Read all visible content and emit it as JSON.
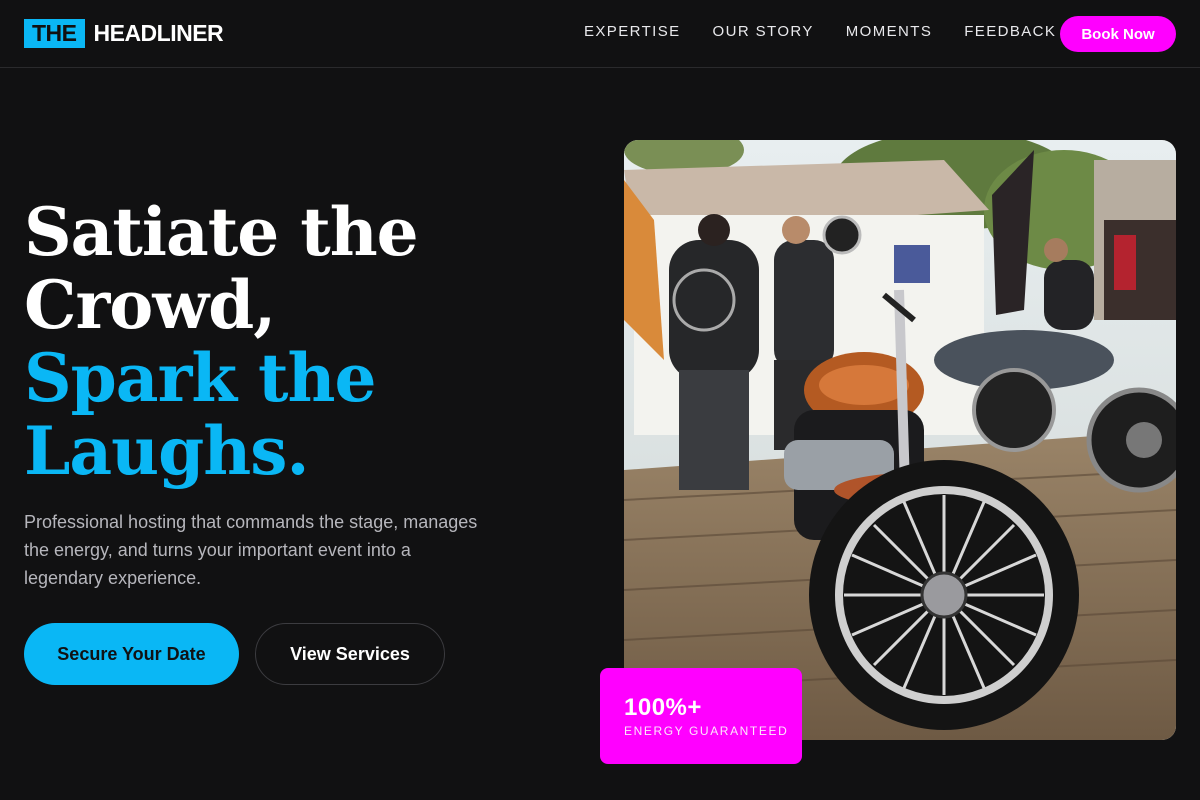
{
  "brand": {
    "logo_box": "THE",
    "logo_text": "HEADLINER"
  },
  "nav": {
    "items": [
      {
        "label": "EXPERTISE"
      },
      {
        "label": "OUR STORY"
      },
      {
        "label": "MOMENTS"
      },
      {
        "label": "FEEDBACK"
      }
    ],
    "cta_label": "Book Now"
  },
  "hero": {
    "title_line1": "Satiate the",
    "title_line2": "Crowd,",
    "title_accent_line1": "Spark the",
    "title_accent_line2": "Laughs.",
    "description": "Professional hosting that commands the stage, manages the energy, and turns your important event into a legendary experience.",
    "primary_button": "Secure Your Date",
    "secondary_button": "View Services"
  },
  "photo": {
    "icon": "motorcycle-photo"
  },
  "badge": {
    "value": "100%+",
    "label": "ENERGY GUARANTEED"
  },
  "colors": {
    "accent": "#0ab7f5",
    "brand_magenta": "#ff00ff",
    "background": "#111112"
  }
}
